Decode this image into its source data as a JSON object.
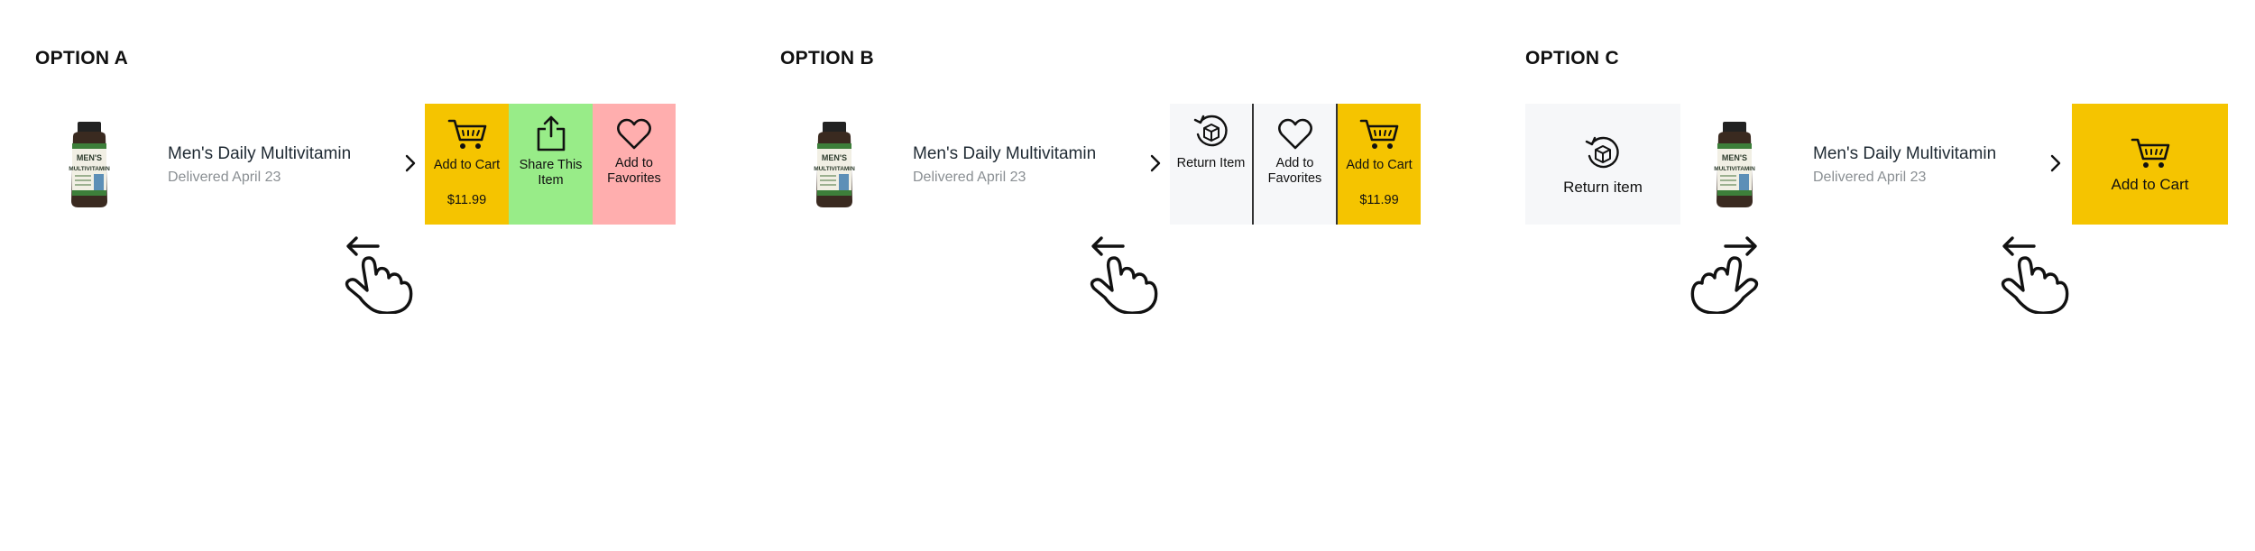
{
  "options": [
    {
      "title": "OPTION A",
      "product": {
        "name": "Men's Daily Multivitamin",
        "delivered": "Delivered April 23"
      },
      "actions": [
        {
          "label": "Add to Cart",
          "price": "$11.99",
          "icon": "cart-icon",
          "color": "#f5c400"
        },
        {
          "label": "Share This Item",
          "icon": "share-icon",
          "color": "#98ec88"
        },
        {
          "label": "Add to Favorites",
          "icon": "heart-icon",
          "color": "#ffaeae"
        }
      ],
      "gesture": "swipe-left"
    },
    {
      "title": "OPTION B",
      "product": {
        "name": "Men's Daily Multivitamin",
        "delivered": "Delivered April 23"
      },
      "actions": [
        {
          "label": "Return Item",
          "icon": "return-box-icon",
          "color": "#f6f7f9"
        },
        {
          "label": "Add to Favorites",
          "icon": "heart-icon",
          "color": "#f6f7f9"
        },
        {
          "label": "Add to Cart",
          "price": "$11.99",
          "icon": "cart-icon",
          "color": "#f5c400"
        }
      ],
      "gesture": "swipe-left"
    },
    {
      "title": "OPTION C",
      "left_action": {
        "label": "Return item",
        "icon": "return-box-icon",
        "color": "#f6f7f9"
      },
      "product": {
        "name": "Men's Daily Multivitamin",
        "delivered": "Delivered April 23"
      },
      "right_action": {
        "label": "Add to Cart",
        "icon": "cart-icon",
        "color": "#f5c400"
      },
      "gestures": [
        "swipe-right",
        "swipe-left"
      ]
    }
  ]
}
